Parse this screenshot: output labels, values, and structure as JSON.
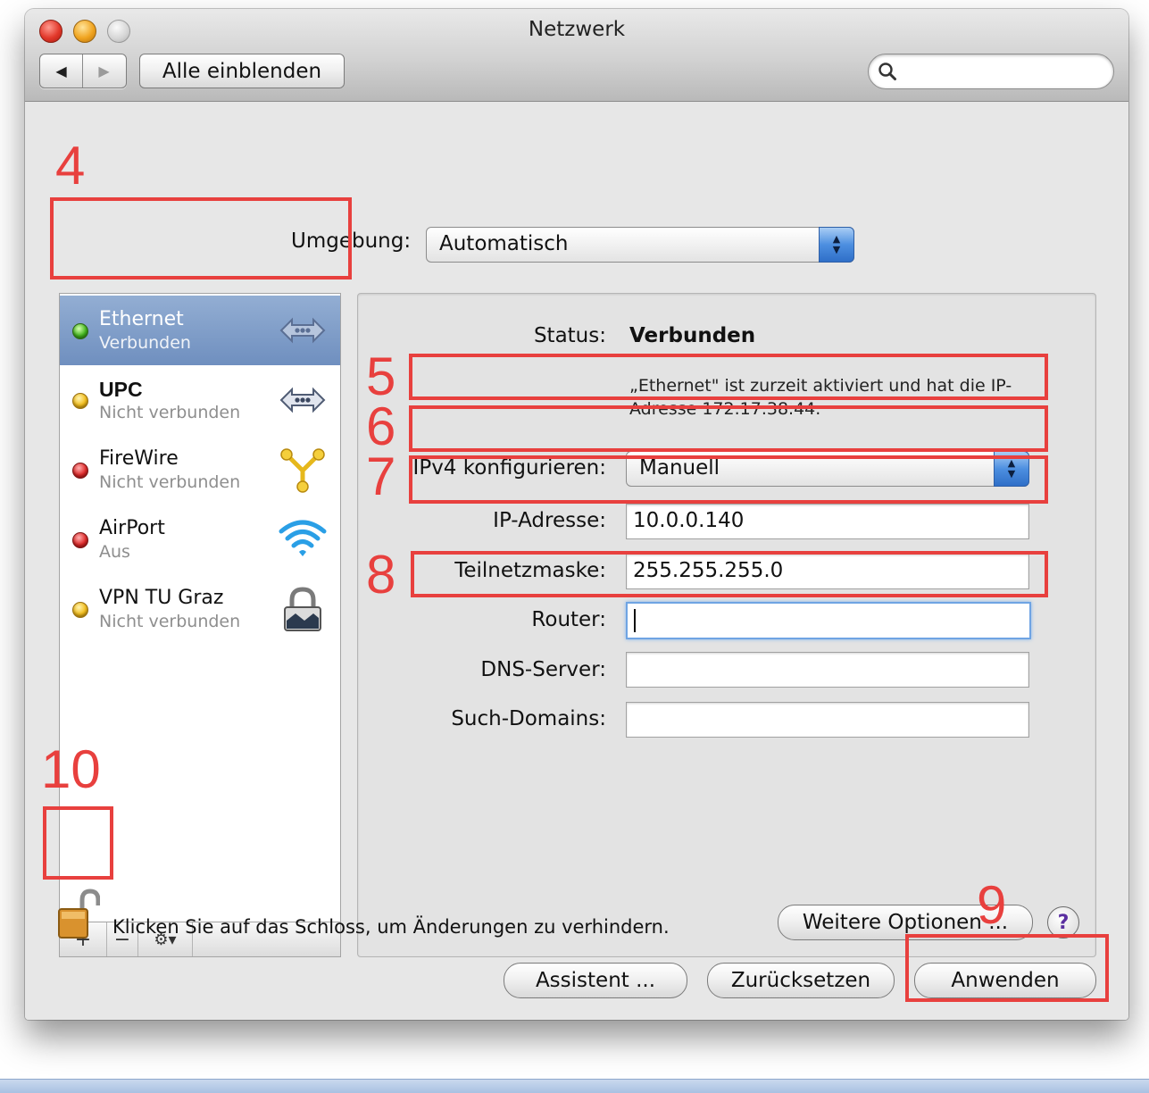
{
  "window": {
    "title": "Netzwerk",
    "show_all_label": "Alle einblenden",
    "back_label": "◀",
    "forward_label": "▶",
    "search_placeholder": ""
  },
  "location": {
    "label": "Umgebung:",
    "value": "Automatisch"
  },
  "services": [
    {
      "name": "Ethernet",
      "status": "Verbunden",
      "indicator": "green",
      "icon": "ethernet-icon",
      "selected": true
    },
    {
      "name": "UPC",
      "status": "Nicht verbunden",
      "indicator": "yellow",
      "icon": "ethernet-icon",
      "selected": false
    },
    {
      "name": "FireWire",
      "status": "Nicht verbunden",
      "indicator": "red",
      "icon": "firewire-icon",
      "selected": false
    },
    {
      "name": "AirPort",
      "status": "Aus",
      "indicator": "red",
      "icon": "wifi-icon",
      "selected": false
    },
    {
      "name": "VPN TU Graz",
      "status": "Nicht verbunden",
      "indicator": "yellow",
      "icon": "lock-icon",
      "selected": false
    }
  ],
  "list_actions": {
    "add_label": "+",
    "remove_label": "−",
    "gear_label": "⚙▾"
  },
  "details": {
    "status_label": "Status:",
    "status_value": "Verbunden",
    "status_description_line1": "„Ethernet\" ist zurzeit aktiviert und hat die IP-",
    "status_description_line2": "Adresse 172.17.38.44.",
    "ipv4_label": "IPv4 konfigurieren:",
    "ipv4_value": "Manuell",
    "ip_label": "IP-Adresse:",
    "ip_value": "10.0.0.140",
    "subnet_label": "Teilnetzmaske:",
    "subnet_value": "255.255.255.0",
    "router_label": "Router:",
    "router_value": "",
    "dns_label": "DNS-Server:",
    "dns_value": "",
    "search_domains_label": "Such-Domains:",
    "search_domains_value": "",
    "more_options_label": "Weitere Optionen ...",
    "help_label": "?"
  },
  "footer": {
    "lock_text": "Klicken Sie auf das Schloss, um Änderungen zu verhindern.",
    "assistant_label": "Assistent ...",
    "reset_label": "Zurücksetzen",
    "apply_label": "Anwenden"
  },
  "annotations": {
    "n4": "4",
    "n5": "5",
    "n6": "6",
    "n7": "7",
    "n8": "8",
    "n9": "9",
    "n10": "10"
  },
  "colors": {
    "annotation": "#e8403e",
    "selection": "#7f9cc8",
    "focus_ring": "#6fa4e3"
  }
}
